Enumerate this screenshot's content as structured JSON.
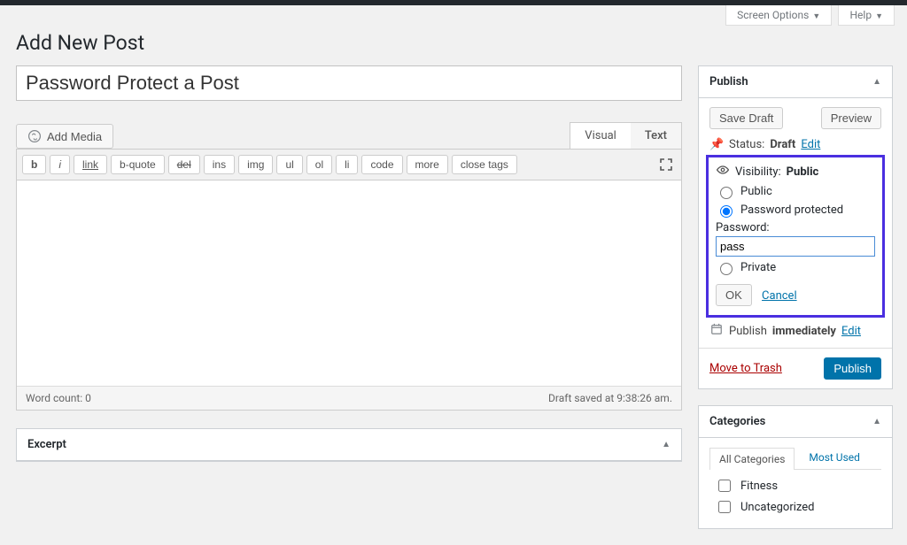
{
  "screen_meta": {
    "screen_options": "Screen Options",
    "help": "Help"
  },
  "page_title": "Add New Post",
  "post_title": "Password Protect a Post",
  "media_button": "Add Media",
  "editor_tabs": {
    "visual": "Visual",
    "text": "Text"
  },
  "quicktags": {
    "b": "b",
    "i": "i",
    "link": "link",
    "bquote": "b-quote",
    "del": "del",
    "ins": "ins",
    "img": "img",
    "ul": "ul",
    "ol": "ol",
    "li": "li",
    "code": "code",
    "more": "more",
    "close": "close tags"
  },
  "editor_footer": {
    "wordcount": "Word count: 0",
    "autosave": "Draft saved at 9:38:26 am."
  },
  "excerpt": {
    "title": "Excerpt"
  },
  "publish": {
    "title": "Publish",
    "save_draft": "Save Draft",
    "preview": "Preview",
    "status_label": "Status:",
    "status_value": "Draft",
    "status_edit": "Edit",
    "visibility_label": "Visibility:",
    "visibility_value": "Public",
    "opt_public": "Public",
    "opt_password": "Password protected",
    "password_label": "Password:",
    "password_value": "pass",
    "opt_private": "Private",
    "ok": "OK",
    "cancel": "Cancel",
    "schedule_prefix": "Publish",
    "schedule_value": "immediately",
    "schedule_edit": "Edit",
    "trash": "Move to Trash",
    "publish": "Publish"
  },
  "categories": {
    "title": "Categories",
    "tab_all": "All Categories",
    "tab_used": "Most Used",
    "items": [
      "Fitness",
      "Uncategorized"
    ]
  }
}
